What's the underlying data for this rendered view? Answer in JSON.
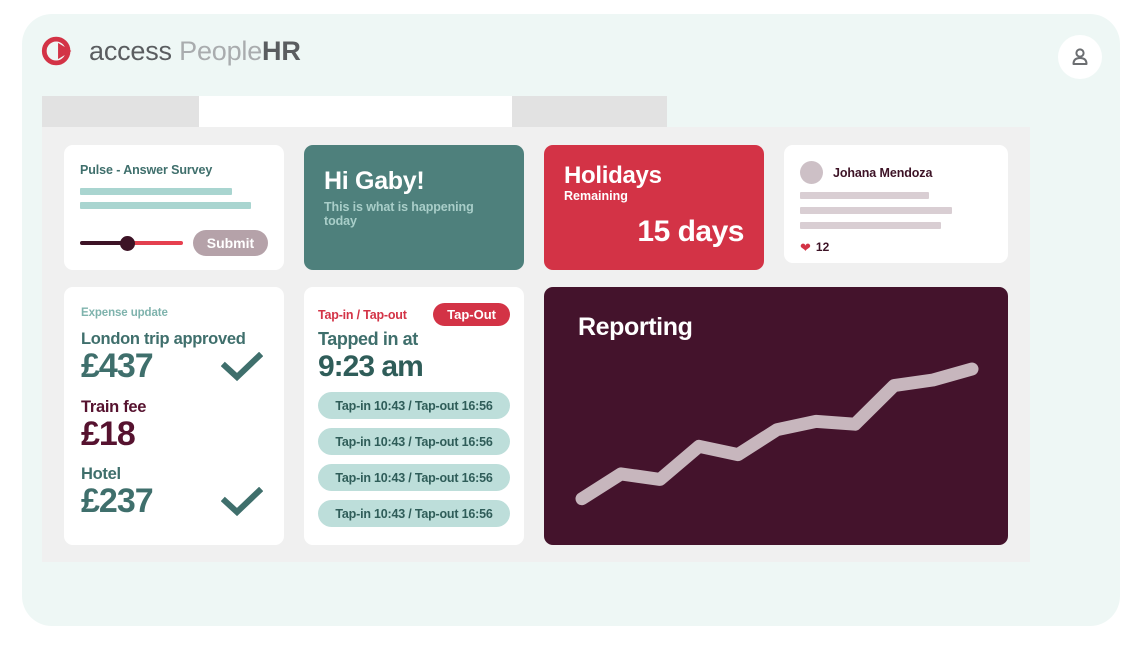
{
  "brand": {
    "access": "access",
    "people": " People",
    "hr": "HR",
    "logo_icon": "access-logo-icon",
    "logo_color": "#d33346"
  },
  "header": {
    "user_icon": "person-icon"
  },
  "tabs": [
    {
      "name": "tab-one",
      "label": ""
    },
    {
      "name": "tab-two",
      "label": "",
      "active": true
    },
    {
      "name": "tab-three",
      "label": ""
    }
  ],
  "pulse_card": {
    "title": "Pulse - Answer Survey",
    "placeholder_bars": 2,
    "slider": {
      "value": 45,
      "min": 0,
      "max": 100
    },
    "submit_label": "Submit",
    "accent": "#3f6f6c",
    "bar_color": "#a9d5d0",
    "button_color": "#b5a2a9"
  },
  "greeting_card": {
    "title": "Hi Gaby!",
    "subtitle": "This is what is happening today",
    "background": "#4e807c"
  },
  "holidays_card": {
    "title": "Holidays",
    "subtitle": "Remaining",
    "value": "15 days",
    "background": "#d33346"
  },
  "feed_card": {
    "author": "Johana Mendoza",
    "avatar_icon": "avatar-circle",
    "placeholder_bars": 3,
    "like_icon": "heart-icon",
    "likes": "12",
    "bar_color": "#d9ced3"
  },
  "expense_card": {
    "kicker": "Expense update",
    "items": [
      {
        "label": "London trip approved",
        "amount": "£437",
        "approved": true,
        "color": "#3f6f6c"
      },
      {
        "label": "Train fee",
        "amount": "£18",
        "approved": false,
        "color": "#56122f"
      },
      {
        "label": "Hotel",
        "amount": "£237",
        "approved": true,
        "color": "#3f6f6c"
      }
    ],
    "check_icon": "check-icon"
  },
  "tap_card": {
    "kicker": "Tap-in / Tap-out",
    "badge_label": "Tap-Out",
    "status_label": "Tapped in at",
    "status_time": "9:23 am",
    "entries": [
      "Tap-in 10:43 / Tap-out 16:56",
      "Tap-in 10:43 / Tap-out 16:56",
      "Tap-in 10:43 / Tap-out 16:56",
      "Tap-in 10:43 / Tap-out 16:56"
    ],
    "badge_color": "#d33346",
    "pill_color": "#bddeda"
  },
  "reporting_card": {
    "title": "Reporting",
    "background": "#44132c",
    "line_color": "#c7b6bd"
  },
  "chart_data": {
    "type": "line",
    "title": "Reporting",
    "xlabel": "",
    "ylabel": "",
    "grid": false,
    "legend": "none",
    "line_color": "#c7b6bd",
    "background": "#44132c",
    "x": [
      0,
      1,
      2,
      3,
      4,
      5,
      6,
      7,
      8,
      9,
      10
    ],
    "y": [
      6,
      24,
      20,
      44,
      38,
      56,
      62,
      60,
      88,
      92,
      100
    ],
    "xlim": [
      0,
      10
    ],
    "ylim": [
      0,
      100
    ]
  }
}
